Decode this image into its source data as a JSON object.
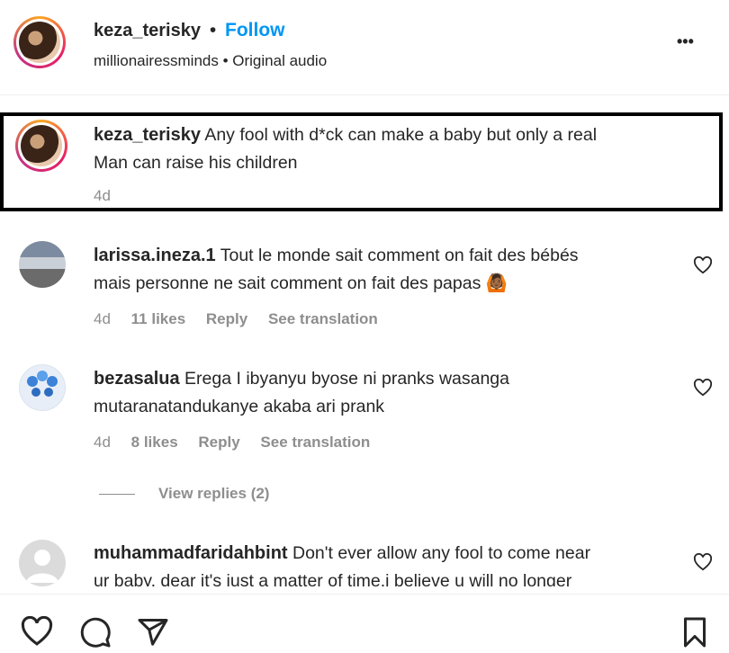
{
  "header": {
    "username": "keza_terisky",
    "separator": "•",
    "follow_label": "Follow",
    "subtitle": "millionairessminds • Original audio",
    "more_label": "•••"
  },
  "caption": {
    "username": "keza_terisky",
    "text_line1": "Any fool with d*ck can make a baby but only a real",
    "text_line2": "Man can raise his children",
    "time": "4d"
  },
  "comments": [
    {
      "username": "larissa.ineza.1",
      "text_line1": "Tout le monde sait comment on fait des bébés",
      "text_line2": "mais personne ne sait comment on fait des papas",
      "emoji": "🙆🏾",
      "time": "4d",
      "likes": "11 likes",
      "reply": "Reply",
      "translate": "See translation"
    },
    {
      "username": "bezasalua",
      "text_line1": "Erega I ibyanyu byose ni pranks wasanga",
      "text_line2": "mutaranatandukanye akaba ari prank",
      "time": "4d",
      "likes": "8 likes",
      "reply": "Reply",
      "translate": "See translation",
      "view_replies": "View replies (2)"
    },
    {
      "username": "muhammadfaridahbint",
      "text_line1": "Don't ever allow any fool to come near",
      "text_line2": "ur baby, dear it's just a matter of time.i believe u will no longer"
    }
  ],
  "colors": {
    "follow": "#0095f6",
    "highlight_border": "#000000",
    "meta": "#8e8e8e"
  }
}
